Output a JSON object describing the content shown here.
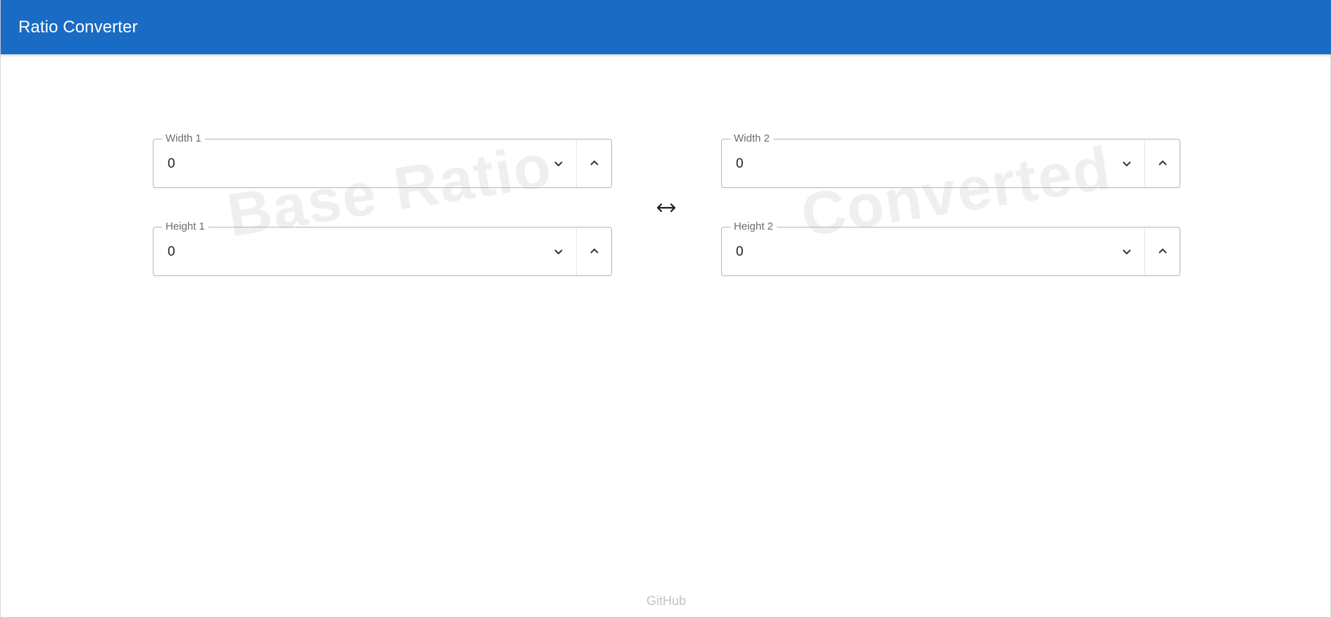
{
  "app": {
    "title": "Ratio Converter"
  },
  "watermarks": {
    "left": "Base Ratio",
    "right": "Converted"
  },
  "fields": {
    "width1": {
      "label": "Width 1",
      "value": "0"
    },
    "height1": {
      "label": "Height 1",
      "value": "0"
    },
    "width2": {
      "label": "Width 2",
      "value": "0"
    },
    "height2": {
      "label": "Height 2",
      "value": "0"
    }
  },
  "icons": {
    "stepper_down": "chevron-down-icon",
    "stepper_up": "chevron-up-icon",
    "swap": "left-right-arrow-icon"
  },
  "colors": {
    "appbar": "#1a6bc4",
    "appbar_text": "#ffffff",
    "watermark": "#efefef",
    "footer_link": "#c2c2c2"
  },
  "footer": {
    "link_label": "GitHub"
  }
}
